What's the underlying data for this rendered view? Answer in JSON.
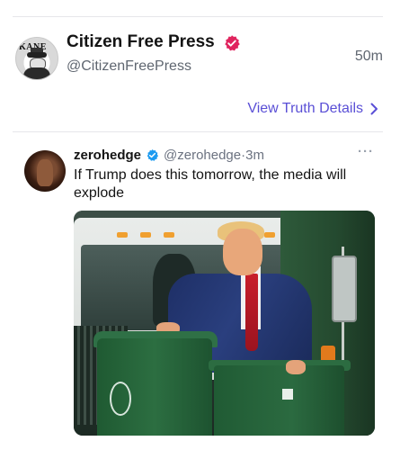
{
  "post": {
    "display_name": "Citizen Free Press",
    "handle": "@CitizenFreePress",
    "time": "50m",
    "avatar_text": "KANE",
    "verified_color": "#e0245e",
    "view_details_label": "View Truth Details",
    "link_color": "#5a4fd6"
  },
  "quoted_post": {
    "display_name": "zerohedge",
    "handle": "@zerohedge",
    "separator": "·",
    "time": "3m",
    "more_label": "···",
    "text": "If Trump does this tomorrow, the media will explode",
    "verified_color": "#1d9bf0",
    "media_description_icon": "image-photo"
  }
}
